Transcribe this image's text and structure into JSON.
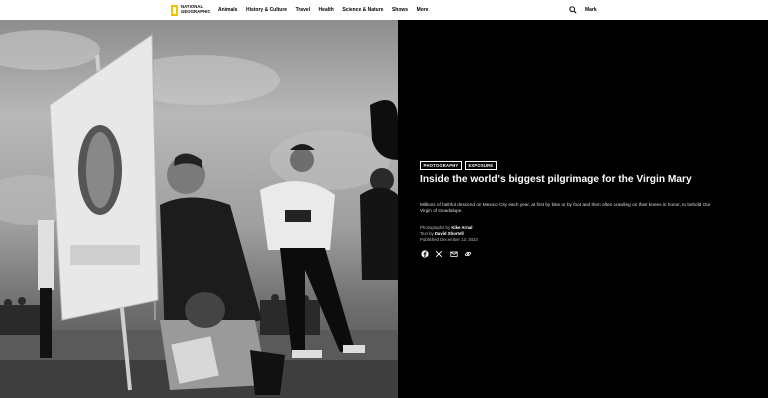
{
  "header": {
    "logo_text_line1": "NATIONAL",
    "logo_text_line2": "GEOGRAPHIC",
    "nav": [
      "Animals",
      "History & Culture",
      "Travel",
      "Health",
      "Science & Nature",
      "Shows",
      "More"
    ],
    "search_icon": "search-icon",
    "user_label": "Mark"
  },
  "article": {
    "tags": [
      "PHOTOGRAPHY",
      "EXPOSURE"
    ],
    "title": "Inside the world's biggest pilgrimage for the Virgin Mary",
    "description": "Millions of faithful descend on Mexico City each year, at first by bike or by foot and then often crawling on their knees in honor, to behold Our Virgin of Guadalupe.",
    "photographs_label": "Photographs by",
    "photographer": "Kike Arnal",
    "text_label": "Text by",
    "author": "David Shortell",
    "published": "Published December 13, 2023"
  },
  "share": [
    "facebook-icon",
    "x-icon",
    "email-icon",
    "link-icon"
  ],
  "colors": {
    "logo_yellow": "#f5c400",
    "panel_bg": "#000000",
    "header_bg": "#ffffff"
  }
}
